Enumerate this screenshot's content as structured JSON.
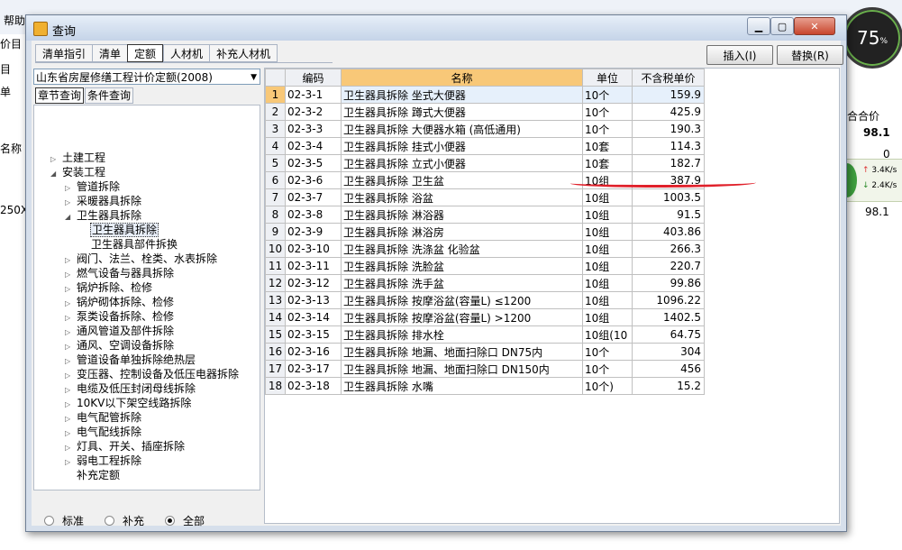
{
  "background": {
    "menu_help": "帮助",
    "left_fragments": [
      "价目",
      "目",
      "单",
      "名称",
      "250X4"
    ],
    "right_fragments": [
      "合合价",
      "98.1",
      "0",
      "98.1"
    ],
    "gauge_value": "75",
    "gauge_unit": "%",
    "net_up": "3.4K/s",
    "net_down": "2.4K/s"
  },
  "dialog": {
    "title": "查询",
    "tabs": [
      "清单指引",
      "清单",
      "定额",
      "人材机",
      "补充人材机"
    ],
    "active_tab": 2,
    "insert_button": "插入(I)",
    "replace_button": "替换(R)",
    "quota_library": "山东省房屋修缮工程计价定额(2008)",
    "subtabs": [
      "章节查询",
      "条件查询"
    ],
    "active_subtab": 0,
    "tree": [
      {
        "label": "土建工程",
        "level": 0,
        "toggle": "▷"
      },
      {
        "label": "安装工程",
        "level": 0,
        "toggle": "◢"
      },
      {
        "label": "管道拆除",
        "level": 1,
        "toggle": "▷"
      },
      {
        "label": "采暖器具拆除",
        "level": 1,
        "toggle": "▷"
      },
      {
        "label": "卫生器具拆除",
        "level": 1,
        "toggle": "◢"
      },
      {
        "label": "卫生器具拆除",
        "level": 2,
        "toggle": "",
        "selected": true
      },
      {
        "label": "卫生器具部件拆换",
        "level": 2,
        "toggle": ""
      },
      {
        "label": "阀门、法兰、栓类、水表拆除",
        "level": 1,
        "toggle": "▷"
      },
      {
        "label": "燃气设备与器具拆除",
        "level": 1,
        "toggle": "▷"
      },
      {
        "label": "锅炉拆除、检修",
        "level": 1,
        "toggle": "▷"
      },
      {
        "label": "锅炉砌体拆除、检修",
        "level": 1,
        "toggle": "▷"
      },
      {
        "label": "泵类设备拆除、检修",
        "level": 1,
        "toggle": "▷"
      },
      {
        "label": "通风管道及部件拆除",
        "level": 1,
        "toggle": "▷"
      },
      {
        "label": "通风、空调设备拆除",
        "level": 1,
        "toggle": "▷"
      },
      {
        "label": "管道设备单独拆除绝热层",
        "level": 1,
        "toggle": "▷"
      },
      {
        "label": "变压器、控制设备及低压电器拆除",
        "level": 1,
        "toggle": "▷"
      },
      {
        "label": "电缆及低压封闭母线拆除",
        "level": 1,
        "toggle": "▷"
      },
      {
        "label": "10KV以下架空线路拆除",
        "level": 1,
        "toggle": "▷"
      },
      {
        "label": "电气配管拆除",
        "level": 1,
        "toggle": "▷"
      },
      {
        "label": "电气配线拆除",
        "level": 1,
        "toggle": "▷"
      },
      {
        "label": "灯具、开关、插座拆除",
        "level": 1,
        "toggle": "▷"
      },
      {
        "label": "弱电工程拆除",
        "level": 1,
        "toggle": "▷"
      },
      {
        "label": "补充定额",
        "level": 1,
        "toggle": ""
      }
    ],
    "filter": {
      "options": [
        "标准",
        "补充",
        "全部"
      ],
      "selected": 2
    },
    "grid": {
      "columns": [
        "",
        "编码",
        "名称",
        "单位",
        "不含税单价"
      ],
      "highlight_column": 2,
      "selected_row": 0,
      "rows": [
        {
          "no": "1",
          "code": "02-3-1",
          "name": "卫生器具拆除 坐式大便器",
          "unit": "10个",
          "price": "159.9"
        },
        {
          "no": "2",
          "code": "02-3-2",
          "name": "卫生器具拆除 蹲式大便器",
          "unit": "10个",
          "price": "425.9"
        },
        {
          "no": "3",
          "code": "02-3-3",
          "name": "卫生器具拆除 大便器水箱 (高低通用)",
          "unit": "10个",
          "price": "190.3"
        },
        {
          "no": "4",
          "code": "02-3-4",
          "name": "卫生器具拆除 挂式小便器",
          "unit": "10套",
          "price": "114.3"
        },
        {
          "no": "5",
          "code": "02-3-5",
          "name": "卫生器具拆除 立式小便器",
          "unit": "10套",
          "price": "182.7"
        },
        {
          "no": "6",
          "code": "02-3-6",
          "name": "卫生器具拆除 卫生盆",
          "unit": "10组",
          "price": "387.9"
        },
        {
          "no": "7",
          "code": "02-3-7",
          "name": "卫生器具拆除 浴盆",
          "unit": "10组",
          "price": "1003.5"
        },
        {
          "no": "8",
          "code": "02-3-8",
          "name": "卫生器具拆除 淋浴器",
          "unit": "10组",
          "price": "91.5"
        },
        {
          "no": "9",
          "code": "02-3-9",
          "name": "卫生器具拆除 淋浴房",
          "unit": "10组",
          "price": "403.86"
        },
        {
          "no": "10",
          "code": "02-3-10",
          "name": "卫生器具拆除 洗涤盆 化验盆",
          "unit": "10组",
          "price": "266.3"
        },
        {
          "no": "11",
          "code": "02-3-11",
          "name": "卫生器具拆除 洗脸盆",
          "unit": "10组",
          "price": "220.7"
        },
        {
          "no": "12",
          "code": "02-3-12",
          "name": "卫生器具拆除 洗手盆",
          "unit": "10组",
          "price": "99.86"
        },
        {
          "no": "13",
          "code": "02-3-13",
          "name": "卫生器具拆除 按摩浴盆(容量L) ≤1200",
          "unit": "10组",
          "price": "1096.22"
        },
        {
          "no": "14",
          "code": "02-3-14",
          "name": "卫生器具拆除 按摩浴盆(容量L) >1200",
          "unit": "10组",
          "price": "1402.5"
        },
        {
          "no": "15",
          "code": "02-3-15",
          "name": "卫生器具拆除 排水栓",
          "unit": "10组(10",
          "price": "64.75"
        },
        {
          "no": "16",
          "code": "02-3-16",
          "name": "卫生器具拆除 地漏、地面扫除口 DN75内",
          "unit": "10个",
          "price": "304"
        },
        {
          "no": "17",
          "code": "02-3-17",
          "name": "卫生器具拆除 地漏、地面扫除口 DN150内",
          "unit": "10个",
          "price": "456"
        },
        {
          "no": "18",
          "code": "02-3-18",
          "name": "卫生器具拆除 水嘴",
          "unit": "10个)",
          "price": "15.2"
        }
      ]
    },
    "annotation_color": "#e0202a"
  }
}
